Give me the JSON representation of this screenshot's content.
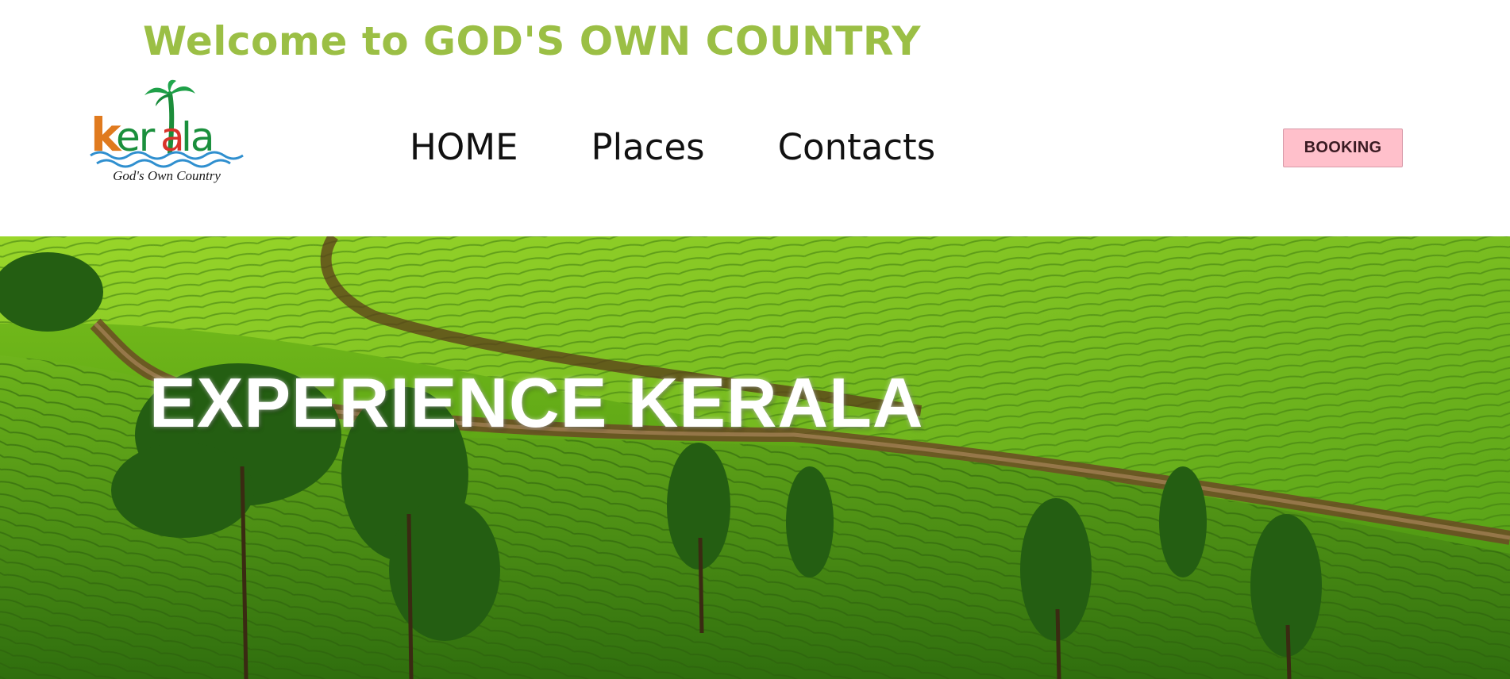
{
  "header": {
    "welcome_title": "Welcome to GOD'S OWN COUNTRY",
    "title_color": "#9bbf45"
  },
  "logo": {
    "wordmark": "kerala",
    "tagline": "God's Own Country",
    "icons": [
      "palm-tree-icon",
      "wave-icon"
    ]
  },
  "nav": {
    "items": [
      "HOME",
      "Places",
      "Contacts"
    ]
  },
  "booking": {
    "label": "BOOKING",
    "background": "#ffc0cb"
  },
  "hero": {
    "title": "EXPERIENCE KERALA",
    "image": "tea-plantation-hills"
  }
}
